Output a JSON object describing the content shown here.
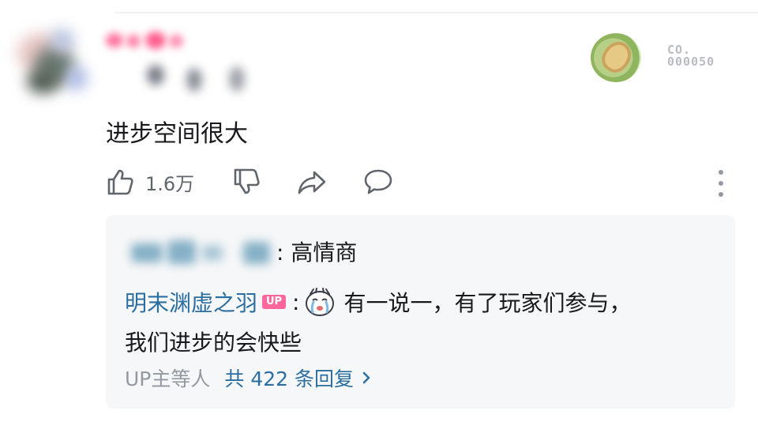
{
  "comment": {
    "text": "进步空间很大",
    "likes": "1.6万"
  },
  "fan_badge": {
    "code_line1": "CO.",
    "code_line2": "000050"
  },
  "reply_preview": {
    "reply1_text": ": 高情商",
    "reply2_name": "明末渊虚之羽",
    "reply2_badge": "UP",
    "reply2_colon": ":",
    "reply2_text_line1": "有一说一，有了玩家们参与，",
    "reply2_text_line2": "我们进步的会快些",
    "more_prefix": "UP主等人",
    "more_link": "共 422 条回复"
  },
  "colors": {
    "link": "#2b6ea1",
    "up_badge": "#ff6699",
    "reply_bg": "#f6f7f8",
    "icon_gray": "#61666d"
  },
  "icons": [
    "thumbs-up-icon",
    "thumbs-down-icon",
    "share-icon",
    "comment-icon",
    "more-vertical-icon",
    "chevron-right-icon",
    "crying-sticker-icon"
  ]
}
